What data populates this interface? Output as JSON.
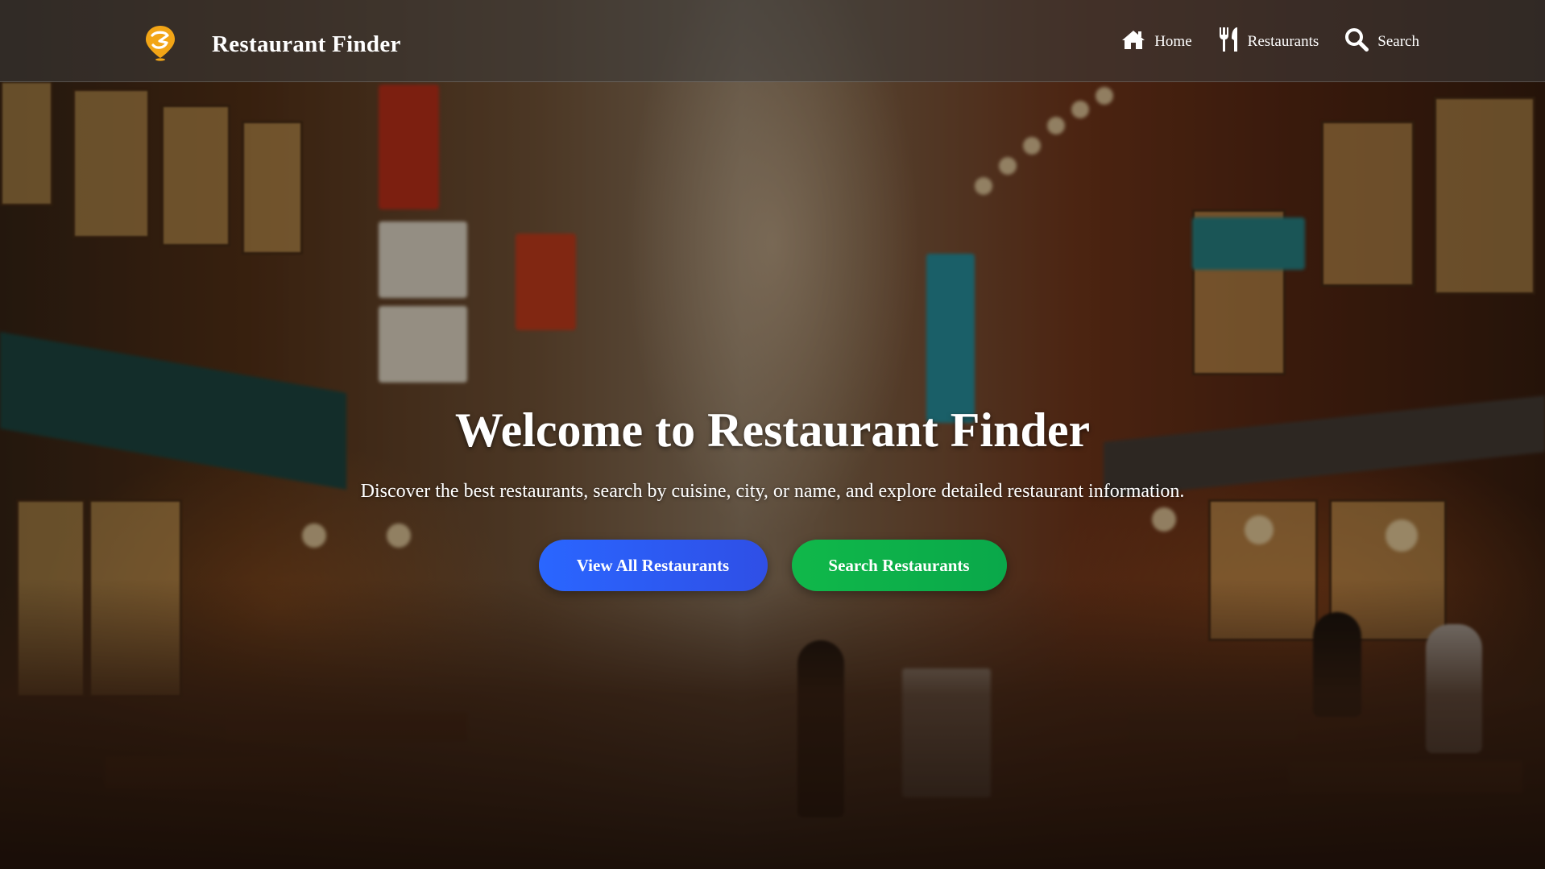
{
  "header": {
    "brand_name": "Restaurant Finder",
    "logo_icon": "pin-logo-icon",
    "nav": [
      {
        "label": "Home",
        "icon": "home-icon"
      },
      {
        "label": "Restaurants",
        "icon": "utensils-icon"
      },
      {
        "label": "Search",
        "icon": "search-icon"
      }
    ]
  },
  "hero": {
    "title": "Welcome to Restaurant Finder",
    "subtitle": "Discover the best restaurants, search by cuisine, city, or name, and explore detailed restaurant information.",
    "primary_button": "View All Restaurants",
    "secondary_button": "Search Restaurants"
  },
  "colors": {
    "primary_button": "#2a66ff",
    "secondary_button": "#10b84a",
    "logo_accent": "#f2a516"
  }
}
